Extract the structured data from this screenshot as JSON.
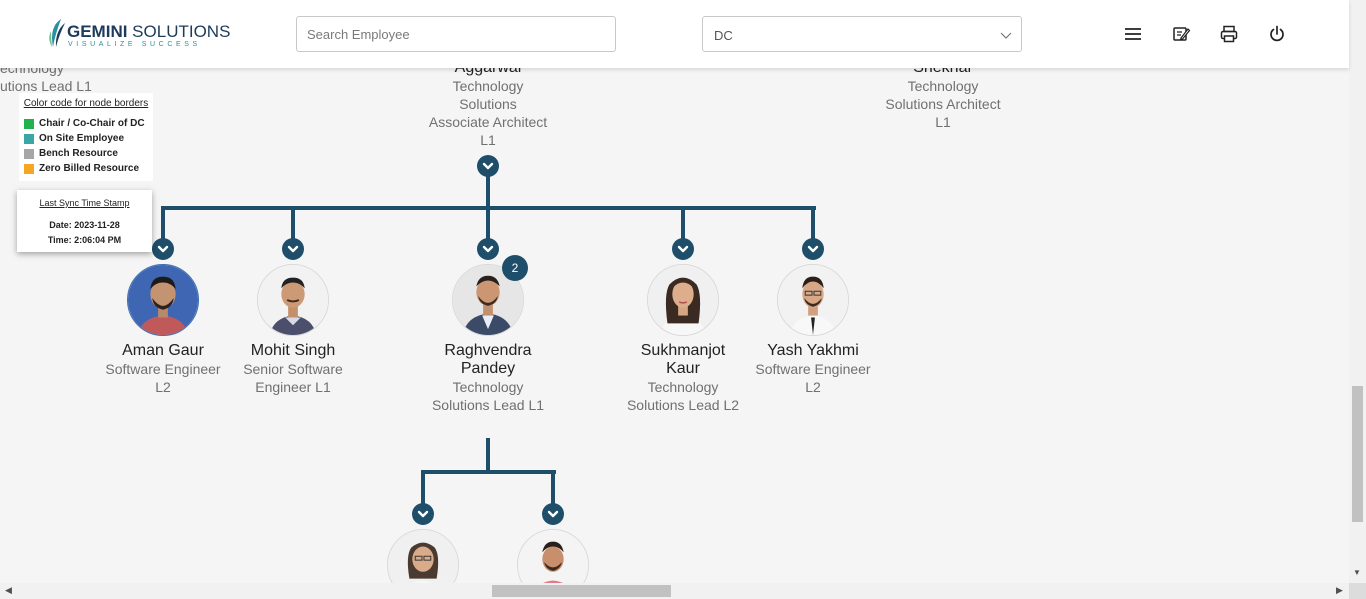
{
  "header": {
    "logo_brand_bold": "GEMINI",
    "logo_brand_light": " SOLUTIONS",
    "logo_tagline": "VISUALIZE SUCCESS",
    "search_placeholder": "Search Employee",
    "dc_selected": "DC",
    "icons": [
      "menu-icon",
      "edit-note-icon",
      "print-icon",
      "power-icon"
    ]
  },
  "legend": {
    "title": "Color code for node borders",
    "items": [
      {
        "label": "Chair / Co-Chair of DC",
        "color": "#22b14c"
      },
      {
        "label": "On Site Employee",
        "color": "#3aa6a6"
      },
      {
        "label": "Bench Resource",
        "color": "#a6a6a6"
      },
      {
        "label": "Zero Billed Resource",
        "color": "#f5a623"
      }
    ]
  },
  "sync": {
    "title": "Last Sync Time Stamp",
    "date": "Date: 2023-11-28",
    "time": "Time: 2:06:04 PM"
  },
  "partial_nodes": {
    "left": {
      "line1": "echnology",
      "line2": "utions Lead L1"
    },
    "center": {
      "name": "Aggarwal",
      "role_lines": [
        "Technology",
        "Solutions",
        "Associate Architect",
        "L1"
      ]
    },
    "right": {
      "name": "Shekhar",
      "role_lines": [
        "Technology",
        "Solutions Architect",
        "L1"
      ]
    }
  },
  "children": [
    {
      "name": "Aman Gaur",
      "role_lines": [
        "Software Engineer",
        "L2"
      ]
    },
    {
      "name": "Mohit Singh",
      "role_lines": [
        "Senior Software",
        "Engineer L1"
      ]
    },
    {
      "name": "Raghvendra Pandey",
      "name_lines": [
        "Raghvendra",
        "Pandey"
      ],
      "role_lines": [
        "Technology",
        "Solutions Lead L1"
      ],
      "reports_count": "2"
    },
    {
      "name": "Sukhmanjot Kaur",
      "name_lines": [
        "Sukhmanjot",
        "Kaur"
      ],
      "role_lines": [
        "Technology",
        "Solutions Lead L2"
      ]
    },
    {
      "name": "Yash Yakhmi",
      "role_lines": [
        "Software Engineer",
        "L2"
      ]
    }
  ],
  "colors": {
    "connector": "#1f4e6b",
    "brand_navy": "#1d3b5a",
    "brand_teal": "#2b8fa0"
  }
}
